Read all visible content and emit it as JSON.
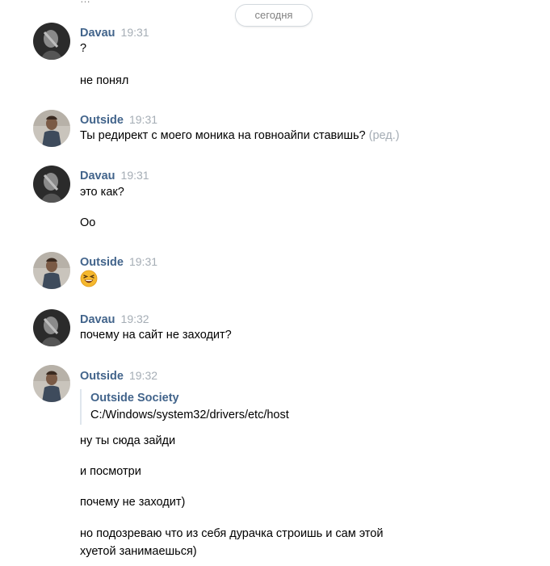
{
  "top_fragment": "…",
  "date_separator": "сегодня",
  "messages": [
    {
      "author": "Davau",
      "time": "19:31",
      "lines": [
        "?",
        "не понял"
      ]
    },
    {
      "author": "Outside",
      "time": "19:31",
      "text": "Ты редирект с моего моника на говноайпи ставишь?",
      "edited_label": "(ред.)"
    },
    {
      "author": "Davau",
      "time": "19:31",
      "lines": [
        "это как?",
        "Оо"
      ]
    },
    {
      "author": "Outside",
      "time": "19:31",
      "emoji": "laughing-emoji"
    },
    {
      "author": "Davau",
      "time": "19:32",
      "lines": [
        "почему на сайт не заходит?"
      ]
    },
    {
      "author": "Outside",
      "time": "19:32",
      "quote": {
        "author": "Outside Society",
        "text": "C:/Windows/system32/drivers/etc/host"
      },
      "lines": [
        "ну ты сюда зайди",
        "и посмотри",
        "почему не заходит)",
        "но подозреваю что из себя дурачка строишь и сам этой",
        "хуетой занимаешься)"
      ]
    }
  ],
  "colors": {
    "author": "#42648b",
    "time": "#a5adb5",
    "text": "#000000",
    "quote_border": "#dfe6ed",
    "pill_border": "#d3d9de"
  },
  "icons": {
    "davau_avatar": "dark-photo-avatar",
    "outside_avatar": "person-photo-avatar",
    "emoji": "grinning-squinting-face"
  }
}
